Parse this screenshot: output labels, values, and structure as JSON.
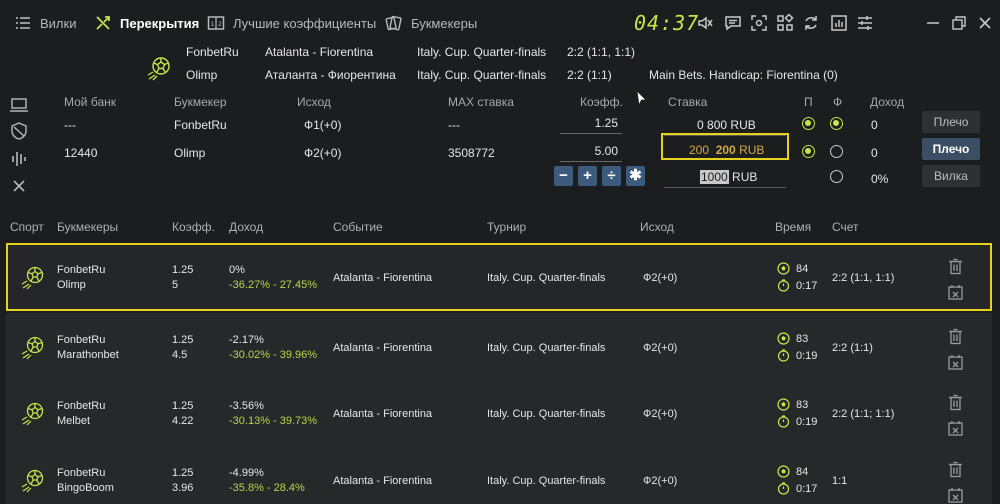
{
  "nav": {
    "forks": "Вилки",
    "overlaps": "Перекрытия",
    "best_odds": "Лучшие коэффициенты",
    "bookmakers": "Букмекеры",
    "timer": "04:37"
  },
  "event": {
    "rows": [
      {
        "bookmaker": "FonbetRu",
        "match": "Atalanta - Fiorentina",
        "tournament": "Italy. Cup. Quarter-finals",
        "score": "2:2 (1:1, 1:1)",
        "market": ""
      },
      {
        "bookmaker": "Olimp",
        "match": "Аталанта - Фиорентина",
        "tournament": "Italy. Cup. Quarter-finals",
        "score": "2:2  (1:1)",
        "market": "Main Bets. Handicap: Fiorentina (0)"
      }
    ]
  },
  "calc": {
    "headers": {
      "bank": "Мой банк",
      "bookmaker": "Букмекер",
      "outcome": "Исход",
      "max_stake": "MAX ставка",
      "odds": "Коэфф.",
      "stake": "Ставка",
      "p": "П",
      "f": "Ф",
      "income": "Доход"
    },
    "rows": [
      {
        "bank": "---",
        "bookmaker": "FonbetRu",
        "outcome": "Ф1(+0)",
        "max_stake": "---",
        "odds": "1.25",
        "stake_a": "0",
        "stake_b": "800",
        "currency": "RUB",
        "income": "0"
      },
      {
        "bank": "12440",
        "bookmaker": "Olimp",
        "outcome": "Ф2(+0)",
        "max_stake": "3508772",
        "odds": "5.00",
        "stake_a": "200",
        "stake_b": "200",
        "currency": "RUB",
        "income": "0"
      }
    ],
    "total": {
      "value": "1000",
      "currency": "RUB",
      "income": "0%"
    },
    "ops": [
      "−",
      "+",
      "÷",
      "✱"
    ],
    "buttons": {
      "leverage1": "Плечо",
      "leverage2": "Плечо",
      "fork": "Вилка"
    }
  },
  "table": {
    "headers": {
      "sport": "Спорт",
      "bookmakers": "Букмекеры",
      "odds": "Коэфф.",
      "income": "Доход",
      "event": "Событие",
      "tournament": "Турнир",
      "outcome": "Исход",
      "time": "Время",
      "score": "Счет"
    },
    "rows": [
      {
        "bk1": "FonbetRu",
        "bk2": "Olimp",
        "o1": "1.25",
        "o2": "5",
        "inc": "0%",
        "inc2": "-36.27% - 27.45%",
        "event": "Atalanta - Fiorentina",
        "tournament": "Italy. Cup. Quarter-finals",
        "outcome": "Ф2(+0)",
        "minute": "84",
        "age": "0:17",
        "score": "2:2 (1:1, 1:1)"
      },
      {
        "bk1": "FonbetRu",
        "bk2": "Marathonbet",
        "o1": "1.25",
        "o2": "4.5",
        "inc": "-2.17%",
        "inc2": "-30.02% - 39.96%",
        "event": "Atalanta - Fiorentina",
        "tournament": "Italy. Cup. Quarter-finals",
        "outcome": "Ф2(+0)",
        "minute": "83",
        "age": "0:19",
        "score": "2:2 (1:1)"
      },
      {
        "bk1": "FonbetRu",
        "bk2": "Melbet",
        "o1": "1.25",
        "o2": "4.22",
        "inc": "-3.56%",
        "inc2": "-30.13% - 39.73%",
        "event": "Atalanta - Fiorentina",
        "tournament": "Italy. Cup. Quarter-finals",
        "outcome": "Ф2(+0)",
        "minute": "83",
        "age": "0:19",
        "score": "2:2 (1:1; 1:1)"
      },
      {
        "bk1": "FonbetRu",
        "bk2": "BingoBoom",
        "o1": "1.25",
        "o2": "3.96",
        "inc": "-4.99%",
        "inc2": "-35.8% - 28.4%",
        "event": "Atalanta - Fiorentina",
        "tournament": "Italy. Cup. Quarter-finals",
        "outcome": "Ф2(+0)",
        "minute": "84",
        "age": "0:17",
        "score": "1:1"
      }
    ]
  },
  "colors": {
    "accent": "#c9e34a",
    "highlight": "#e6d21c",
    "button": "#3c5a7c"
  }
}
